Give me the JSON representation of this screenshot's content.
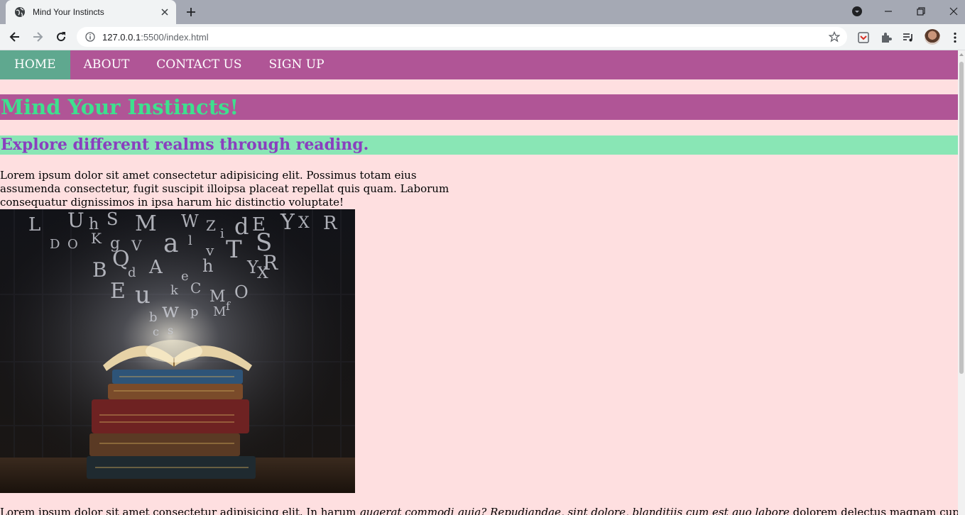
{
  "browser": {
    "tab_title": "Mind Your Instincts",
    "url_host": "127.0.0.1",
    "url_rest": ":5500/index.html"
  },
  "nav": {
    "items": [
      {
        "label": "HOME"
      },
      {
        "label": "ABOUT"
      },
      {
        "label": "CONTACT US"
      },
      {
        "label": "SIGN UP"
      }
    ]
  },
  "page": {
    "title": "Mind Your Instincts!",
    "subtitle": "Explore different realms through reading.",
    "intro": "Lorem ipsum dolor sit amet consectetur adipisicing elit. Possimus totam eius assumenda consectetur, fugit suscipit illoipsa placeat repellat quis quam. Laborum consequatur dignissimos in ipsa harum hic distinctio voluptate!",
    "para2_a": "Lorem ipsum dolor sit amet consectetur adipisicing elit. In harum ",
    "para2_em": "quaerat commodi quia? Repudiandae, sint dolore, blanditiis cum est quo labore",
    "para2_b": " dolorem delectus magnam cupiditate, ex"
  },
  "image": {
    "letters": [
      "L",
      "U",
      "h",
      "S",
      "M",
      "W",
      "Z",
      "i",
      "d",
      "E",
      "Y",
      "X",
      "R",
      "D",
      "O",
      "K",
      "g",
      "V",
      "a",
      "l",
      "v",
      "T",
      "S",
      "Q",
      "R",
      "B",
      "d",
      "A",
      "e",
      "h",
      "Y",
      "X",
      "E",
      "u",
      "k",
      "C",
      "M",
      "O",
      "w",
      "p",
      "b",
      "M",
      "f",
      "c",
      "s"
    ]
  },
  "colors": {
    "nav_bg": "#b05596",
    "nav_active": "#5fa88f",
    "page_bg": "#fedfe0",
    "h1_bg": "#b05596",
    "h1_text": "#3ee08e",
    "h2_bg": "#89e6b5",
    "h2_text": "#8a3fbf"
  }
}
